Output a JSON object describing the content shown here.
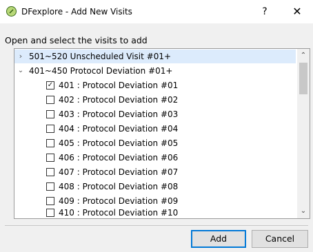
{
  "window": {
    "title": "DFexplore - Add New Visits",
    "help_label": "?",
    "close_label": "✕",
    "icon": "dfexplore-app-icon"
  },
  "instructions": "Open and select the visits to add",
  "tree": {
    "groups": [
      {
        "label": "501~520 Unscheduled Visit #01+",
        "expanded": false,
        "selected": true,
        "arrow": "›"
      },
      {
        "label": "401~450 Protocol Deviation #01+",
        "expanded": true,
        "selected": false,
        "arrow": "⌄",
        "items": [
          {
            "label": "401 : Protocol Deviation #01",
            "checked": true
          },
          {
            "label": "402 : Protocol Deviation #02",
            "checked": false
          },
          {
            "label": "403 : Protocol Deviation #03",
            "checked": false
          },
          {
            "label": "404 : Protocol Deviation #04",
            "checked": false
          },
          {
            "label": "405 : Protocol Deviation #05",
            "checked": false
          },
          {
            "label": "406 : Protocol Deviation #06",
            "checked": false
          },
          {
            "label": "407 : Protocol Deviation #07",
            "checked": false
          },
          {
            "label": "408 : Protocol Deviation #08",
            "checked": false
          },
          {
            "label": "409 : Protocol Deviation #09",
            "checked": false
          },
          {
            "label": "410 : Protocol Deviation #10",
            "checked": false
          }
        ]
      }
    ]
  },
  "buttons": {
    "add_label": "Add",
    "cancel_label": "Cancel"
  },
  "colors": {
    "selection": "#dcebfc",
    "default_button_border": "#0078d7"
  }
}
